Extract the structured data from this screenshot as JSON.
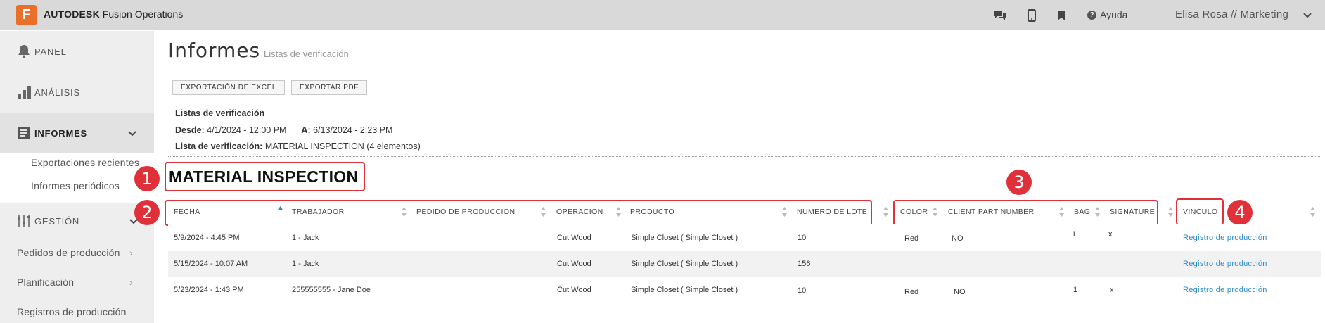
{
  "topbar": {
    "logo_letter": "F",
    "brand_bold": "AUTODESK",
    "brand_rest": "Fusion Operations",
    "help_label": "Ayuda",
    "user_label": "Elisa Rosa // Marketing",
    "icons": [
      "chat-icon",
      "mobile-icon",
      "bookmark-icon",
      "help-icon",
      "chevron-down-icon"
    ]
  },
  "sidebar": {
    "items": [
      {
        "label": "PANEL",
        "icon": "bell-icon"
      },
      {
        "label": "ANÁLISIS",
        "icon": "bar-chart-icon"
      },
      {
        "label": "INFORMES",
        "icon": "report-icon"
      },
      {
        "label": "GESTIÓN",
        "icon": "sliders-icon"
      }
    ],
    "informes_sub": [
      "Exportaciones recientes",
      "Informes periódicos"
    ],
    "gestion_sub": [
      "Pedidos de producción",
      "Planificación",
      "Registros de producción"
    ]
  },
  "page": {
    "title": "Informes",
    "subtitle": "Listas de verificación",
    "export_excel": "EXPORTACIÓN DE EXCEL",
    "export_pdf": "EXPORTAR PDF",
    "meta_heading": "Listas de verificación",
    "desde_label": "Desde:",
    "desde_value": "4/1/2024 - 12:00 PM",
    "a_label": "A:",
    "a_value": "6/13/2024 - 2:23 PM",
    "lista_label": "Lista de verificación:",
    "lista_value": "MATERIAL INSPECTION (4 elementos)",
    "section_title": "MATERIAL INSPECTION"
  },
  "annotations": [
    "1",
    "2",
    "3",
    "4"
  ],
  "table": {
    "headers": [
      "FECHA",
      "TRABAJADOR",
      "PEDIDO DE PRODUCCIÓN",
      "OPERACIÓN",
      "PRODUCTO",
      "NUMERO DE LOTE",
      "COLOR",
      "CLIENT PART NUMBER",
      "BAG",
      "SIGNATURE",
      "VÍNCULO"
    ],
    "rows": [
      {
        "fecha": "5/9/2024 - 4:45 PM",
        "trabajador": "1 - Jack",
        "pedido": "",
        "operacion": "Cut Wood",
        "producto": "Simple Closet ( Simple Closet )",
        "lote": "10",
        "color": "Red",
        "client_part": "NO",
        "bag": "1",
        "signature": "x",
        "vinculo": "Registro de producción"
      },
      {
        "fecha": "5/15/2024 - 10:07 AM",
        "trabajador": "1 - Jack",
        "pedido": "",
        "operacion": "Cut Wood",
        "producto": "Simple Closet ( Simple Closet )",
        "lote": "156",
        "color": "",
        "client_part": "",
        "bag": "",
        "signature": "",
        "vinculo": "Registro de producción"
      },
      {
        "fecha": "5/23/2024 - 1:43 PM",
        "trabajador": "255555555 - Jane Doe",
        "pedido": "",
        "operacion": "Cut Wood",
        "producto": "Simple Closet ( Simple Closet )",
        "lote": "10",
        "color": "Red",
        "client_part": "NO",
        "bag": "1",
        "signature": "x",
        "vinculo": "Registro de producción"
      }
    ]
  },
  "colors": {
    "accent": "#e8702a",
    "annotation_red": "#e0313b",
    "link": "#2b88c8",
    "sort_active": "#2b88c8"
  }
}
